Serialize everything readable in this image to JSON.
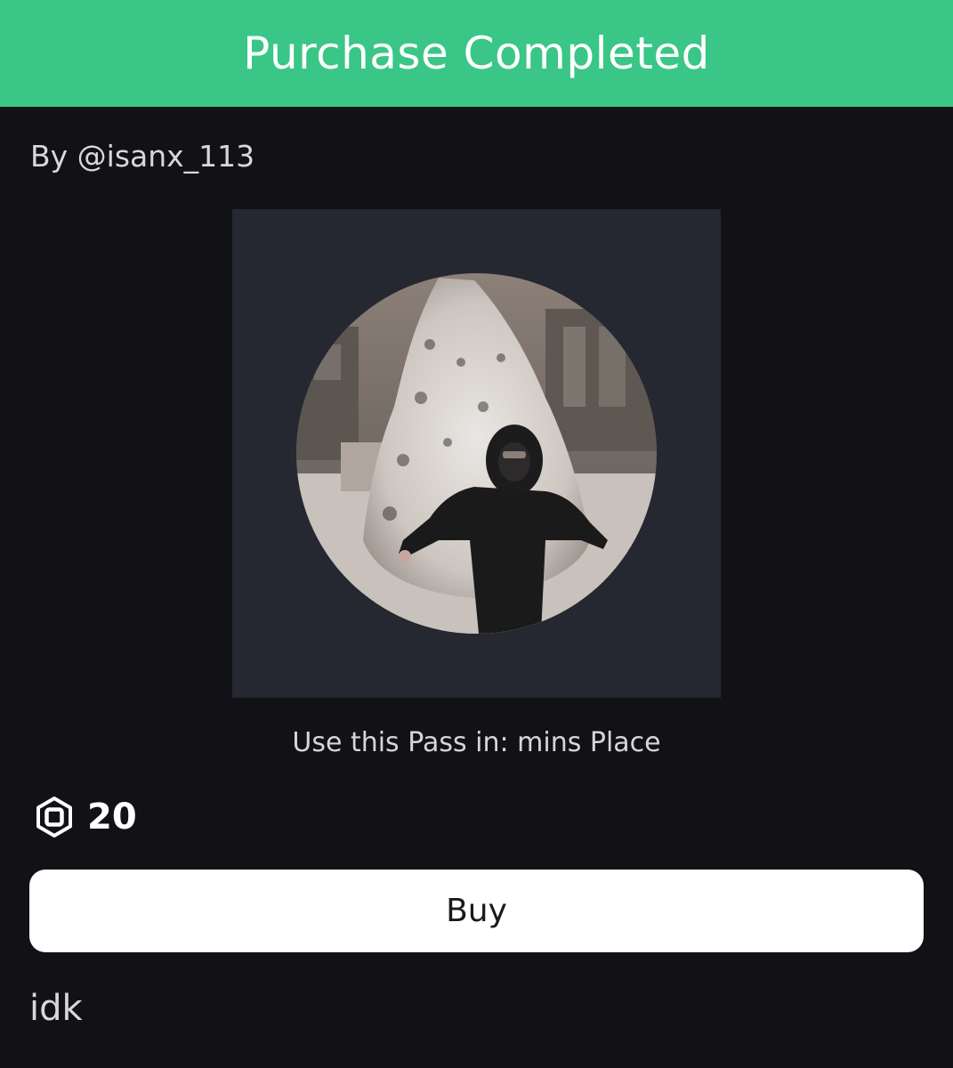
{
  "banner": {
    "title": "Purchase Completed",
    "color": "#39c686"
  },
  "item": {
    "creator": "By @isanx_113",
    "thumbnail_icon": "profile-photo",
    "use_pass_text": "Use this Pass in: mins Place",
    "price": "20",
    "currency_icon": "robux-icon",
    "buy_label": "Buy",
    "description": "idk"
  }
}
